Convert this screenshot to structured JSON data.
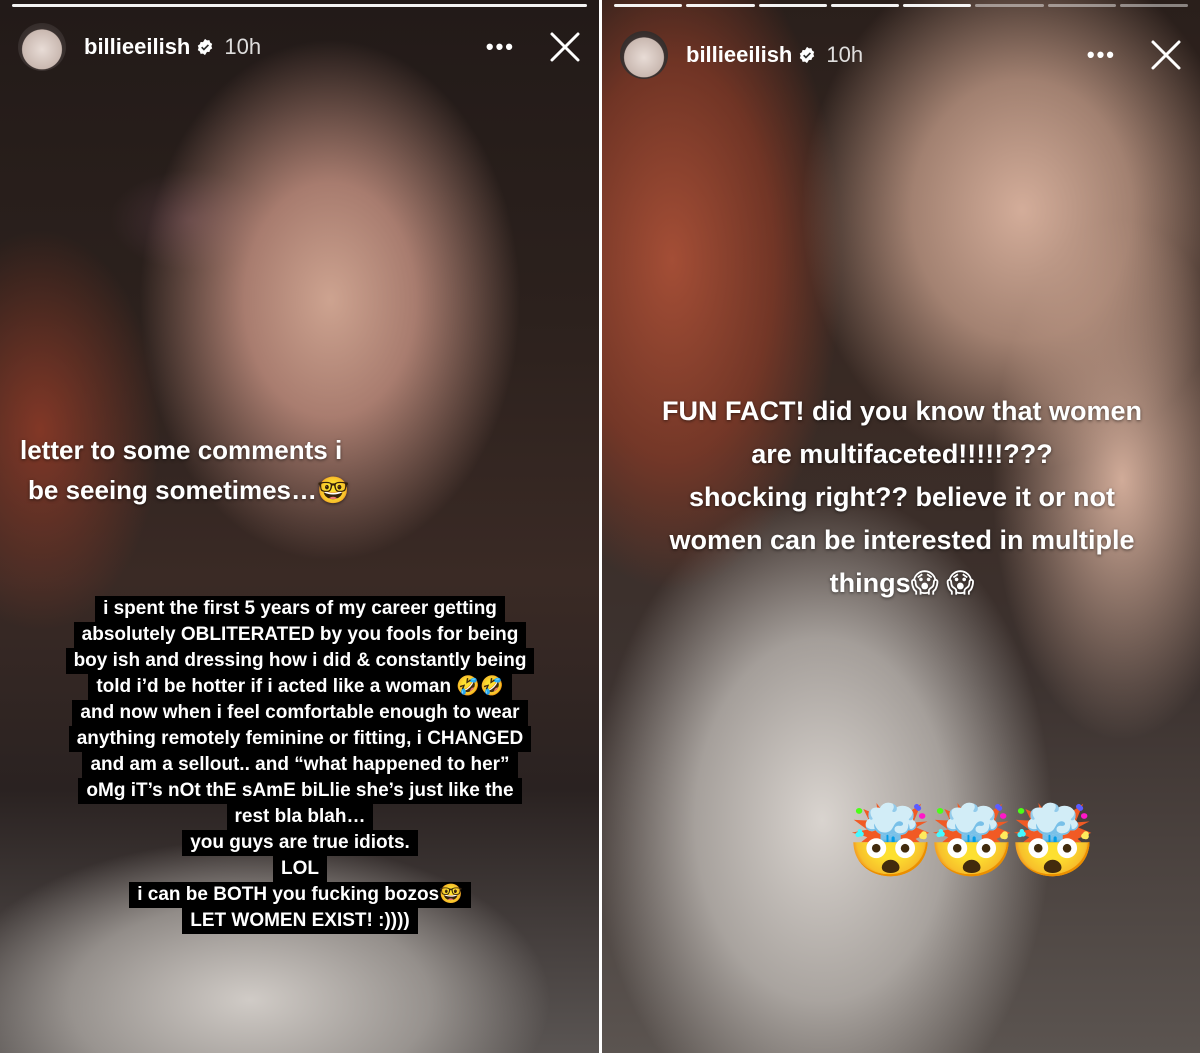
{
  "left_story": {
    "username": "billieeilish",
    "time": "10h",
    "more_label": "•••",
    "progress_segments": 1,
    "caption_lines": [
      "letter to some comments i",
      "be seeing sometimes…🤓"
    ],
    "boxed_lines": [
      "i spent the first 5 years of my career getting",
      "absolutely OBLITERATED by you fools for being",
      "boy ish and dressing how i did & constantly being",
      "told i’d be hotter if i acted like a woman 🤣🤣",
      "and now when i feel comfortable enough to wear",
      "anything remotely feminine or fitting, i CHANGED",
      "and am a sellout.. and “what happened to her”",
      "oMg iT’s nOt thE sAmE biLlie she’s just like the",
      "rest bla blah…",
      "you guys are true idiots.",
      "LOL",
      "i can be BOTH you fucking bozos🤓",
      "LET WOMEN EXIST! :))))"
    ]
  },
  "right_story": {
    "username": "billieeilish",
    "time": "10h",
    "more_label": "•••",
    "progress_segments": 8,
    "progress_done": 5,
    "caption_lines": [
      "FUN FACT! did you know that women",
      "are multifaceted!!!!!???",
      "shocking right?? believe it or not",
      "women can be interested in multiple",
      "things😱 😱"
    ],
    "sticker": "🤯🤯🤯"
  },
  "colors": {
    "text": "#ffffff",
    "caption_box": "#000000",
    "divider": "#ffffff"
  }
}
